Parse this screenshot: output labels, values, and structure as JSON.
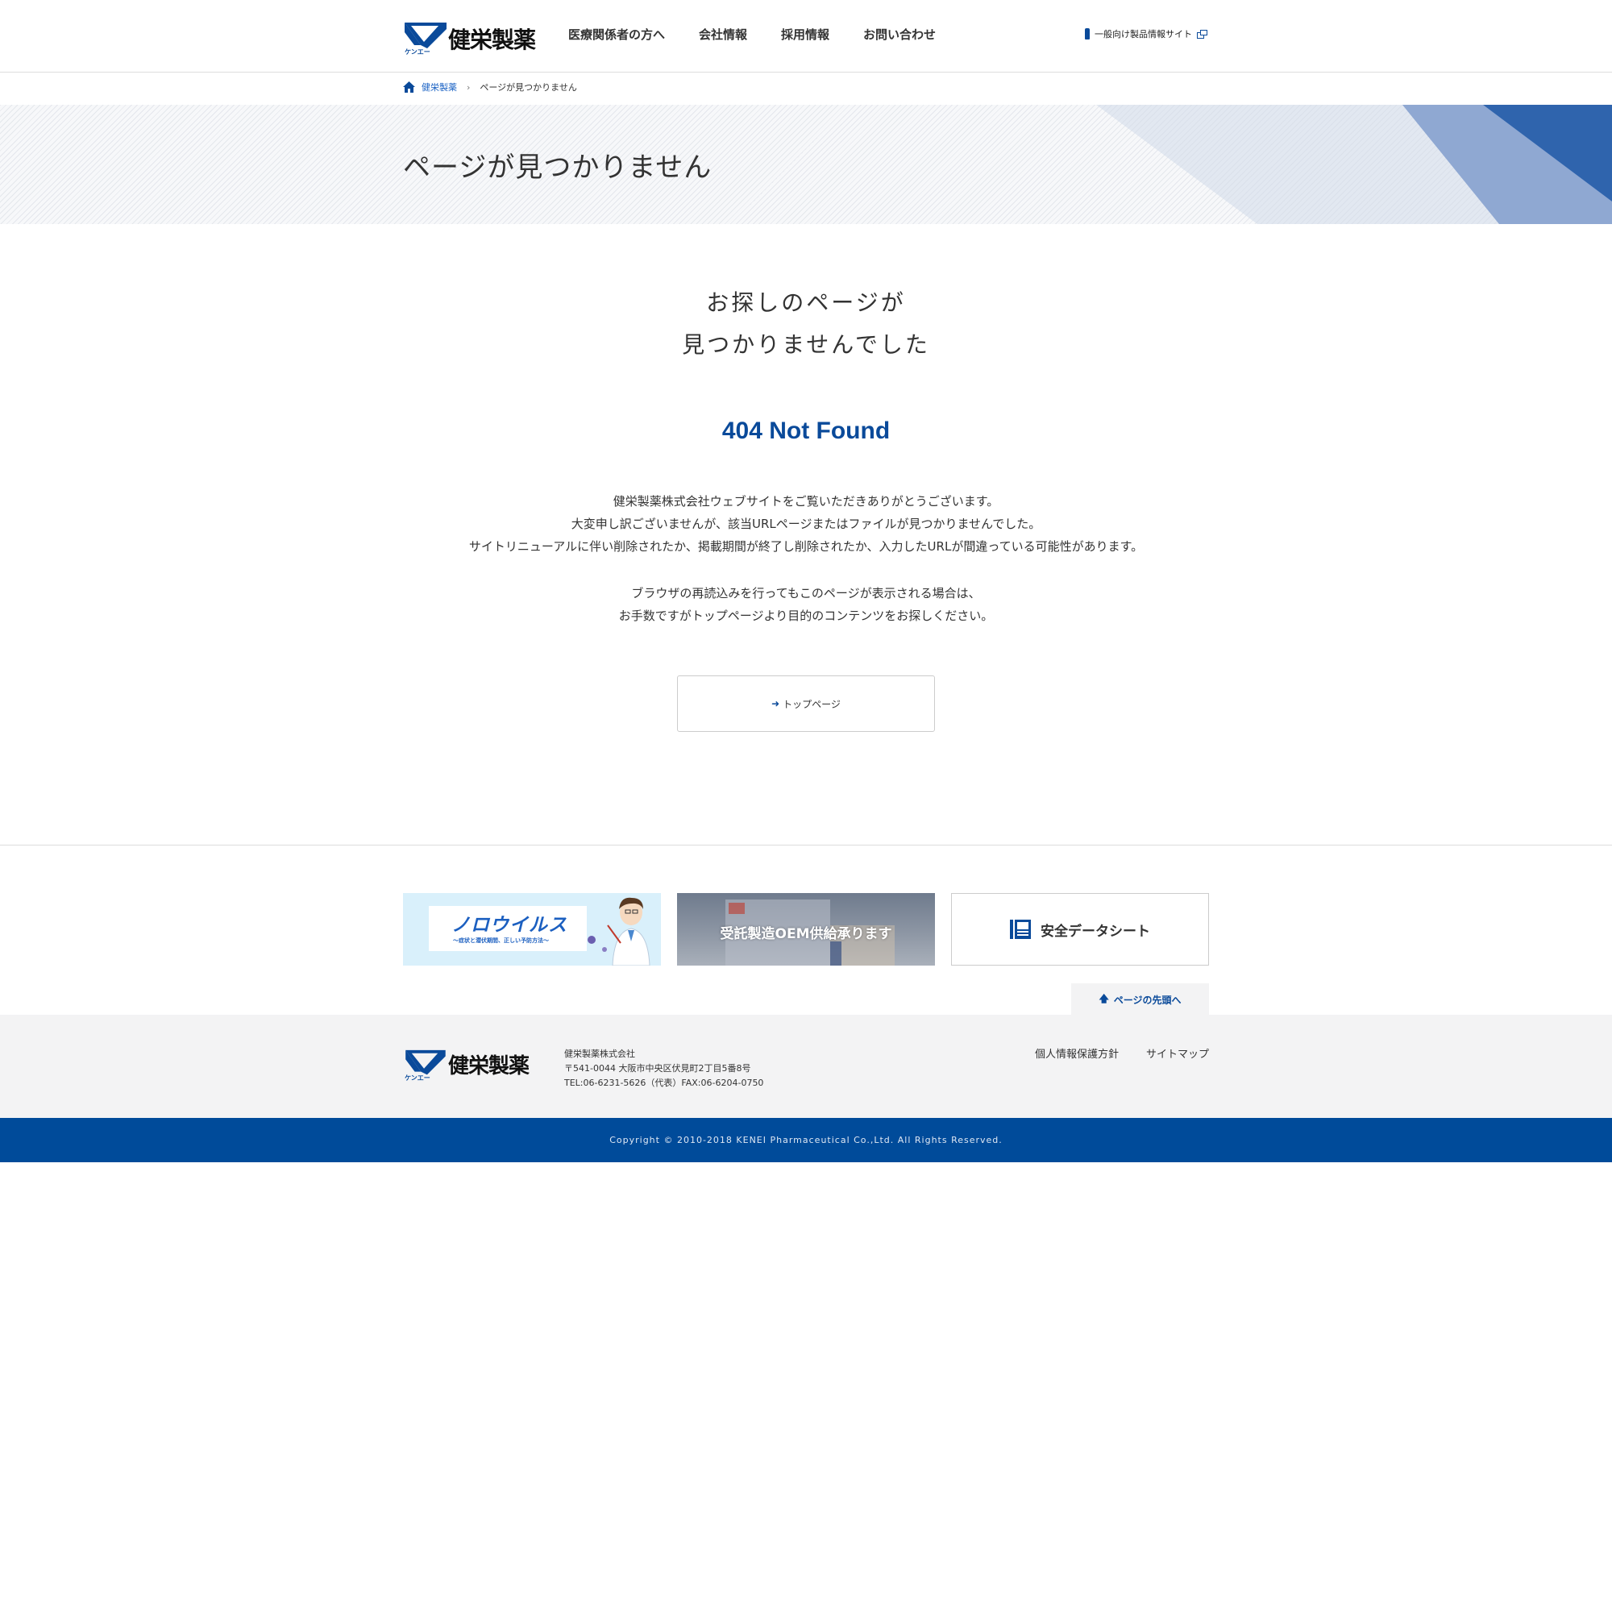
{
  "header": {
    "logo_text": "健栄製薬",
    "logo_kana": "ケンエー",
    "nav": [
      {
        "label": "医療関係者の方へ"
      },
      {
        "label": "会社情報"
      },
      {
        "label": "採用情報"
      },
      {
        "label": "お問い合わせ"
      }
    ],
    "consumer_link": "一般向け製品情報サイト"
  },
  "breadcrumb": {
    "home": "健栄製薬",
    "current": "ページが見つかりません"
  },
  "title_band": {
    "title": "ページが見つかりません"
  },
  "main": {
    "heading_line1": "お探しのページが",
    "heading_line2": "見つかりませんでした",
    "status": "404 Not Found",
    "desc_lines": [
      "健栄製薬株式会社ウェブサイトをご覧いただきありがとうございます。",
      "大変申し訳ございませんが、該当URLページまたはファイルが見つかりませんでした。",
      "サイトリニューアルに伴い削除されたか、掲載期間が終了し削除されたか、入力したURLが間違っている可能性があります。"
    ],
    "desc_lines2": [
      "ブラウザの再読込みを行ってもこのページが表示される場合は、",
      "お手数ですがトップページより目的のコンテンツをお探しください。"
    ],
    "top_button": "トップページ"
  },
  "banners": {
    "norovirus_title": "ノロウイルス",
    "norovirus_sub": "〜症状と潜伏期間、正しい予防方法〜",
    "oem": "受託製造OEM供給承ります",
    "sds": "安全データシート"
  },
  "pagetop": "ページの先頭へ",
  "footer": {
    "logo_text": "健栄製薬",
    "logo_kana": "ケンエー",
    "company_name": "健栄製薬株式会社",
    "address": "〒541-0044 大阪市中央区伏見町2丁目5番8号",
    "tel": "TEL:06-6231-5626（代表）FAX:06-6204-0750",
    "links": [
      "個人情報保護方針",
      "サイトマップ"
    ],
    "copyright": "Copyright © 2010-2018 KENEI Pharmaceutical Co.,Ltd. All Rights Reserved."
  },
  "colors": {
    "brand_blue": "#004b9a",
    "link_blue": "#1a62c4",
    "footer_bg": "#f3f3f4"
  }
}
